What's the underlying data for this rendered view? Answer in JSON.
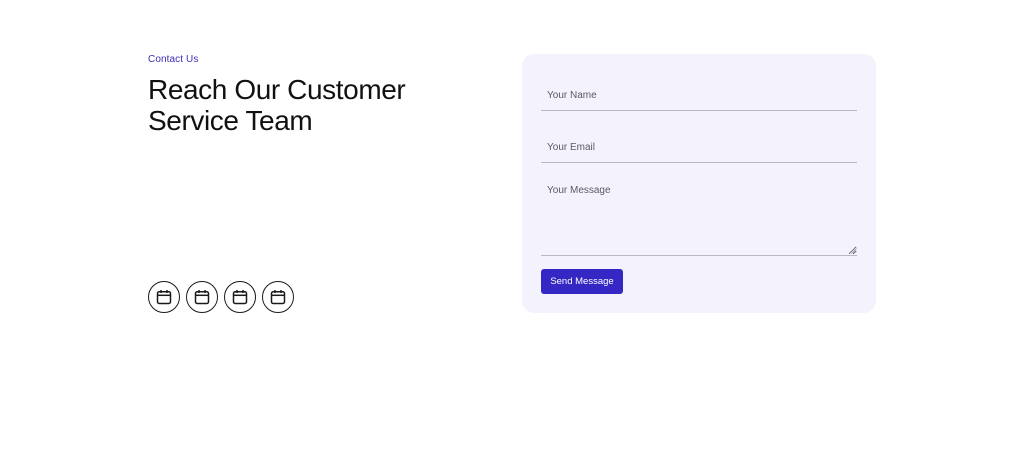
{
  "contact": {
    "eyebrow": "Contact Us",
    "heading_line1": "Reach Our Customer",
    "heading_line2": "Service Team"
  },
  "socials": [
    {
      "icon": "calendar-icon"
    },
    {
      "icon": "calendar-icon"
    },
    {
      "icon": "calendar-icon"
    },
    {
      "icon": "calendar-icon"
    }
  ],
  "form": {
    "name_placeholder": "Your Name",
    "email_placeholder": "Your Email",
    "message_placeholder": "Your Message",
    "submit_label": "Send Message"
  },
  "colors": {
    "accent": "#3427c4",
    "eyebrow": "#3a2fb8",
    "card_background": "#f4f3fd"
  }
}
